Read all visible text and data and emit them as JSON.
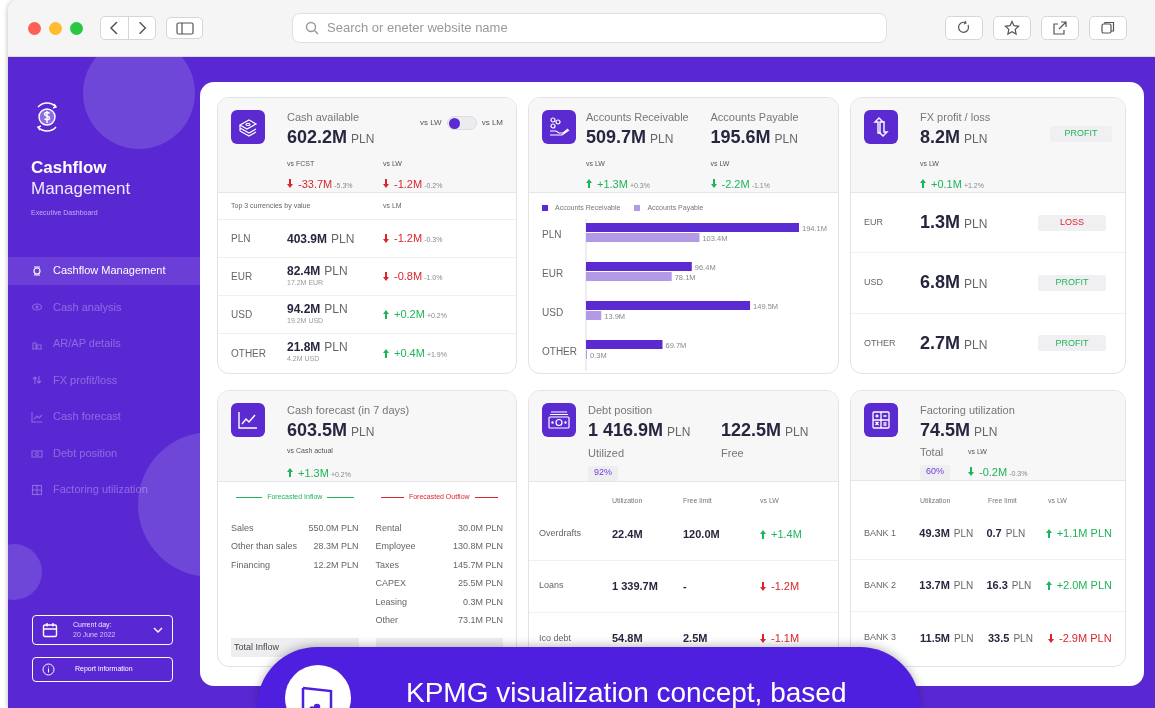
{
  "browser": {
    "address_placeholder": "Search or eneter website name"
  },
  "sidebar": {
    "title": "Cashflow",
    "subtitle": "Management",
    "caption": "Executive Dashboard",
    "items": [
      {
        "label": "Cashflow Management",
        "selected": true
      },
      {
        "label": "Cash analysis",
        "selected": false
      },
      {
        "label": "AR/AP details",
        "selected": false
      },
      {
        "label": "FX profit/loss",
        "selected": false
      },
      {
        "label": "Cash forecast",
        "selected": false
      },
      {
        "label": "Debt position",
        "selected": false
      },
      {
        "label": "Factoring utilization",
        "selected": false
      }
    ],
    "date": {
      "label": "Current day:",
      "value": "20 June 2022"
    },
    "report_button": "Report information"
  },
  "cash_available": {
    "title": "Cash available",
    "value": "602.2M",
    "unit": "PLN",
    "toggle": {
      "left_label": "vs LW",
      "right_label": "vs LM",
      "on": false
    },
    "comparisons": [
      {
        "label": "vs FCST",
        "value": "-33.7M",
        "percent": "-5.3%",
        "up": false,
        "favorable": false
      },
      {
        "label": "vs LW",
        "value": "-1.2M",
        "percent": "-0.2%",
        "up": false,
        "favorable": false
      }
    ],
    "table": {
      "caption": "Top 3 currencies by value",
      "compare_label": "vs LM",
      "rows": [
        {
          "currency": "PLN",
          "value": "403.9M",
          "unit": "PLN",
          "delta": {
            "value": "-1.2M",
            "percent": "-0.3%",
            "up": false,
            "favorable": false
          }
        },
        {
          "currency": "EUR",
          "value": "82.4M",
          "unit": "PLN",
          "original": "17.2M EUR",
          "delta": {
            "value": "-0.8M",
            "percent": "-1.0%",
            "up": false,
            "favorable": false
          }
        },
        {
          "currency": "USD",
          "value": "94.2M",
          "unit": "PLN",
          "original": "19.2M USD",
          "delta": {
            "value": "+0.2M",
            "percent": "+0.2%",
            "up": true,
            "favorable": true
          }
        },
        {
          "currency": "OTHER",
          "value": "21.8M",
          "unit": "PLN",
          "original": "4.2M USD",
          "delta": {
            "value": "+0.4M",
            "percent": "+1.9%",
            "up": true,
            "favorable": true
          }
        }
      ]
    }
  },
  "receivables_payables": {
    "figures": [
      {
        "title": "Accounts Receivable",
        "value": "509.7M",
        "unit": "PLN",
        "comparison": {
          "label": "vs LW",
          "value": "+1.3M",
          "percent": "+0.3%",
          "up": true,
          "favorable": true
        }
      },
      {
        "title": "Accounts Payable",
        "value": "195.6M",
        "unit": "PLN",
        "comparison": {
          "label": "vs LW",
          "value": "-2.2M",
          "percent": "-1.1%",
          "up": false,
          "favorable": true
        }
      }
    ],
    "chart_data": {
      "type": "bar",
      "orientation": "horizontal",
      "legend": "top",
      "categories": [
        "PLN",
        "EUR",
        "USD",
        "OTHER"
      ],
      "series": [
        {
          "name": "Accounts Receivable",
          "color": "#5b2bd1",
          "values": [
            194.1,
            96.4,
            149.5,
            69.7
          ],
          "value_labels": [
            "194.1M",
            "96.4M",
            "149.5M",
            "69.7M"
          ]
        },
        {
          "name": "Accounts Payable",
          "color": "#b39ae6",
          "values": [
            103.4,
            78.1,
            13.9,
            0.3
          ],
          "value_labels": [
            "103.4M",
            "78.1M",
            "13.9M",
            "0.3M"
          ]
        }
      ]
    }
  },
  "fx_profit_loss": {
    "title": "FX profit / loss",
    "value": "8.2M",
    "unit": "PLN",
    "status": {
      "label": "PROFIT",
      "favorable": true
    },
    "comparison": {
      "label": "vs LW",
      "value": "+0.1M",
      "percent": "+1.2%",
      "up": true,
      "favorable": true
    },
    "rows": [
      {
        "currency": "EUR",
        "value": "1.3M",
        "unit": "PLN",
        "status": {
          "label": "LOSS",
          "favorable": false
        }
      },
      {
        "currency": "USD",
        "value": "6.8M",
        "unit": "PLN",
        "status": {
          "label": "PROFIT",
          "favorable": true
        }
      },
      {
        "currency": "OTHER",
        "value": "2.7M",
        "unit": "PLN",
        "status": {
          "label": "PROFIT",
          "favorable": true
        }
      }
    ]
  },
  "cash_forecast": {
    "title": "Cash forecast (in 7 days)",
    "value": "603.5M",
    "unit": "PLN",
    "comparison": {
      "label": "vs Cash actual",
      "value": "+1.3M",
      "percent": "+0.2%",
      "up": true,
      "favorable": true
    },
    "flows": [
      {
        "title": "Forecasted Inflow",
        "favorable": true,
        "items": [
          {
            "label": "Sales",
            "value": "550.0M PLN"
          },
          {
            "label": "Other than sales",
            "value": "28.3M PLN"
          },
          {
            "label": "Financing",
            "value": "12.2M PLN"
          }
        ],
        "total": {
          "label": "Total Inflow"
        }
      },
      {
        "title": "Forecasted Outflow",
        "favorable": false,
        "items": [
          {
            "label": "Rental",
            "value": "30.0M PLN"
          },
          {
            "label": "Employee",
            "value": "130.8M PLN"
          },
          {
            "label": "Taxes",
            "value": "145.7M PLN"
          },
          {
            "label": "CAPEX",
            "value": "25.5M PLN"
          },
          {
            "label": "Leasing",
            "value": "0.3M PLN"
          },
          {
            "label": "Other",
            "value": "73.1M PLN"
          }
        ]
      }
    ]
  },
  "debt_position": {
    "title": "Debt position",
    "figures": [
      {
        "value": "1 416.9M",
        "unit": "PLN",
        "label": "Utilized",
        "share": "92%"
      },
      {
        "value": "122.5M",
        "unit": "PLN",
        "label": "Free"
      }
    ],
    "columns": [
      "Utilization",
      "Free limit",
      "vs LW"
    ],
    "rows": [
      {
        "label": "Overdrafts",
        "utilization": "22.4M",
        "free_limit": "120.0M",
        "delta": {
          "value": "+1.4M",
          "up": true,
          "favorable": true
        }
      },
      {
        "label": "Loans",
        "utilization": "1 339.7M",
        "free_limit": "-",
        "delta": {
          "value": "-1.2M",
          "up": false,
          "favorable": false
        }
      },
      {
        "label": "Ico debt",
        "utilization": "54.8M",
        "free_limit": "2.5M",
        "delta": {
          "value": "-1.1M",
          "up": false,
          "favorable": false
        }
      }
    ]
  },
  "factoring_utilization": {
    "title": "Factoring utilization",
    "value": "74.5M",
    "unit": "PLN",
    "label": "Total",
    "share": "60%",
    "comparison": {
      "label": "vs LW",
      "value": "-0.2M",
      "percent": "-0.3%",
      "up": false,
      "favorable": true
    },
    "columns": [
      "Utilization",
      "Free limit",
      "vs LW"
    ],
    "rows": [
      {
        "bank": "BANK 1",
        "utilization": "49.3M",
        "utilization_unit": "PLN",
        "free_limit": "0.7",
        "free_limit_unit": "PLN",
        "delta": {
          "value": "+1.1M PLN",
          "up": true,
          "favorable": true
        }
      },
      {
        "bank": "BANK 2",
        "utilization": "13.7M",
        "utilization_unit": "PLN",
        "free_limit": "16.3",
        "free_limit_unit": "PLN",
        "delta": {
          "value": "+2.0M PLN",
          "up": true,
          "favorable": true
        }
      },
      {
        "bank": "BANK 3",
        "utilization": "11.5M",
        "utilization_unit": "PLN",
        "free_limit": "33.5",
        "free_limit_unit": "PLN",
        "delta": {
          "value": "-2.9M PLN",
          "up": false,
          "favorable": false
        }
      }
    ]
  },
  "banner": {
    "text": "KPMG visualization concept, based"
  }
}
